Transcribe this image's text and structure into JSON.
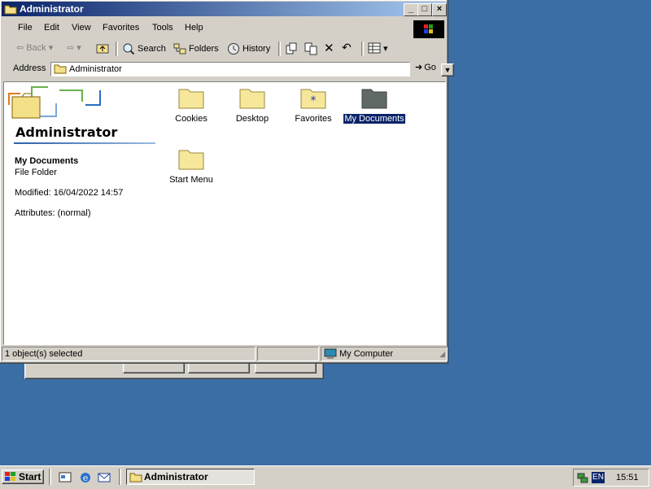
{
  "window": {
    "title": "Administrator",
    "menu": [
      "File",
      "Edit",
      "View",
      "Favorites",
      "Tools",
      "Help"
    ],
    "toolbar": {
      "back": "Back",
      "search": "Search",
      "folders": "Folders",
      "history": "History"
    },
    "address": {
      "label": "Address",
      "value": "Administrator",
      "go": "Go"
    },
    "panel": {
      "title": "Administrator",
      "selected_name": "My Documents",
      "selected_type": "File Folder",
      "modified": "Modified: 16/04/2022 14:57",
      "attributes": "Attributes: (normal)"
    },
    "items": [
      {
        "label": "Cookies",
        "icon": "folder-icon"
      },
      {
        "label": "Desktop",
        "icon": "folder-icon"
      },
      {
        "label": "Favorites",
        "icon": "favorites-folder-icon"
      },
      {
        "label": "My Documents",
        "icon": "my-documents-folder-icon",
        "selected": true
      },
      {
        "label": "Start Menu",
        "icon": "folder-icon"
      }
    ],
    "status": {
      "left": "1 object(s) selected",
      "zone": "My Computer"
    }
  },
  "taskbar": {
    "start": "Start",
    "task": "Administrator",
    "lang": "EN",
    "clock": "15:51"
  },
  "colors": {
    "desktop": "#3a6ea5",
    "titlebar_start": "#0a246a",
    "titlebar_end": "#a6caf0",
    "selection": "#0a246a"
  }
}
